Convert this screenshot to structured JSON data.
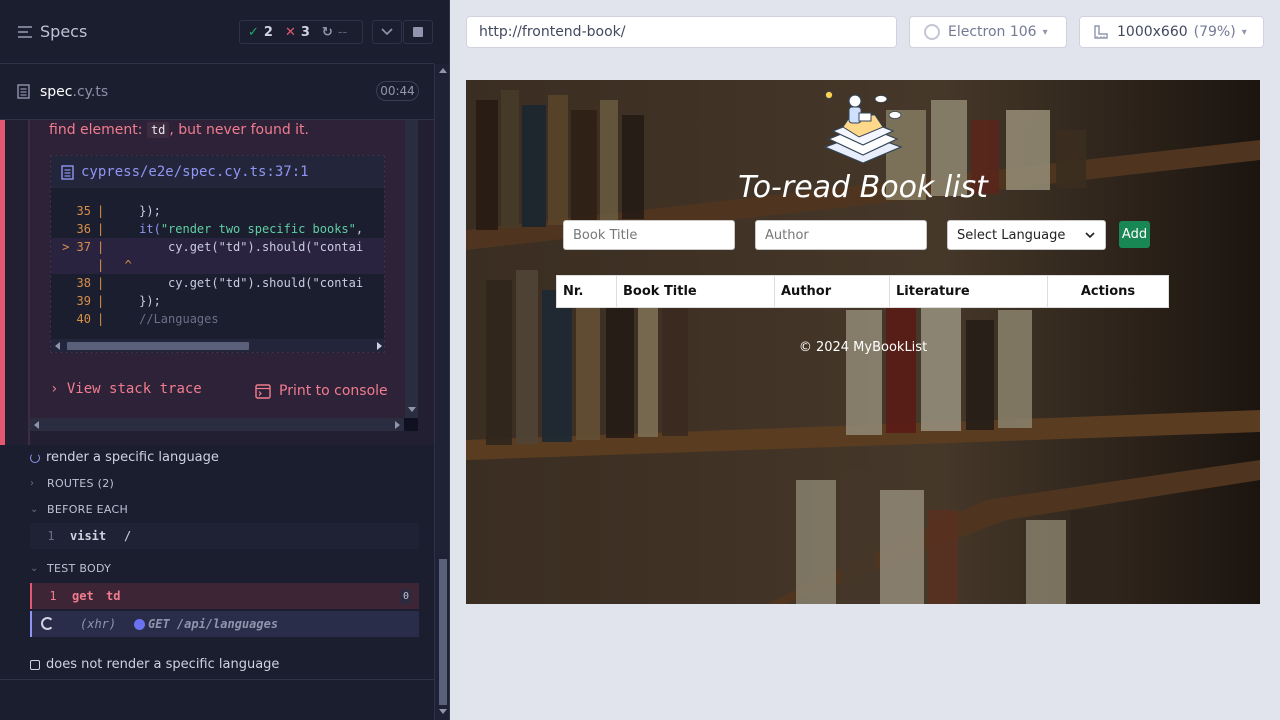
{
  "reporter": {
    "header": {
      "title": "Specs",
      "passed": "2",
      "failed": "3",
      "pending": "--"
    },
    "spec": {
      "name": "spec",
      "ext": ".cy.ts",
      "duration": "00:44"
    },
    "error": {
      "message_prefix": "find element: ",
      "message_code": "td",
      "message_suffix": ", but never found it.",
      "file_link": "cypress/e2e/spec.cy.ts:37:1",
      "code_lines": [
        {
          "ln": "35",
          "marker": "",
          "code": "    });"
        },
        {
          "ln": "36",
          "marker": "",
          "code_kw": "    it(",
          "code_str": "\"render two specific books\"",
          "code_rest": ","
        },
        {
          "ln": "37",
          "marker": "> ",
          "code": "        cy.get(\"td\").should(\"contai"
        },
        {
          "ln": "",
          "marker": "",
          "code": "  ^"
        },
        {
          "ln": "38",
          "marker": "",
          "code": "        cy.get(\"td\").should(\"contai"
        },
        {
          "ln": "39",
          "marker": "",
          "code": "    });"
        },
        {
          "ln": "40",
          "marker": "",
          "code": "    //Languages"
        }
      ],
      "view_stack": "View stack trace",
      "print_console": "Print to console"
    },
    "tests": {
      "running_test": "render a specific language",
      "routes": "ROUTES (2)",
      "before_each": "BEFORE EACH",
      "visit_num": "1",
      "visit_name": "visit",
      "visit_arg": "/",
      "test_body": "TEST BODY",
      "get_num": "1",
      "get_name": "get",
      "get_arg": "td",
      "get_badge": "0",
      "xhr_name": "(xhr)",
      "xhr_arg": "GET /api/languages",
      "next_test": "does not render a specific language"
    }
  },
  "aut": {
    "url": "http://frontend-book/",
    "browser": "Electron 106",
    "viewport": "1000x660",
    "scale": "(79%)",
    "app": {
      "title": "To-read Book list",
      "book_title_placeholder": "Book Title",
      "author_placeholder": "Author",
      "language_select": "Select Language",
      "add_label": "Add",
      "table_headers": [
        "Nr.",
        "Book Title",
        "Author",
        "Literature",
        "Actions"
      ],
      "footer": "© 2024 MyBookList"
    }
  }
}
